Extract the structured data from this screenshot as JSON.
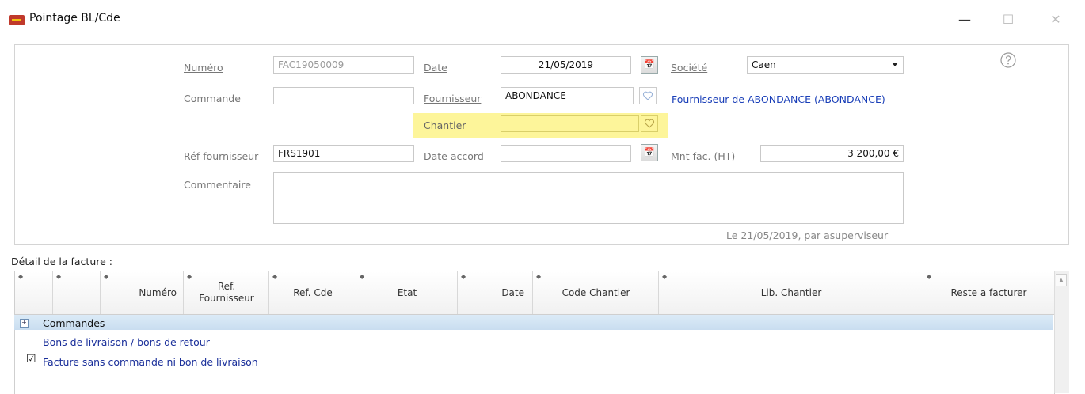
{
  "window": {
    "title": "Pointage BL/Cde",
    "minimize_glyph": "—",
    "maximize_glyph": "☐",
    "close_glyph": "✕"
  },
  "form": {
    "numero": {
      "label": "Numéro",
      "value": "FAC19050009"
    },
    "date": {
      "label": "Date",
      "value": "21/05/2019"
    },
    "societe": {
      "label": "Société",
      "value": "Caen"
    },
    "commande": {
      "label": "Commande",
      "value": ""
    },
    "fournisseur": {
      "label": "Fournisseur",
      "value": "ABONDANCE",
      "link": "Fournisseur de ABONDANCE (ABONDANCE)"
    },
    "chantier": {
      "label": "Chantier",
      "value": ""
    },
    "ref_fournisseur": {
      "label": "Réf fournisseur",
      "value": "FRS1901"
    },
    "date_accord": {
      "label": "Date accord",
      "value": ""
    },
    "mnt_fac": {
      "label": "Mnt fac. (HT)",
      "value": "3 200,00 €"
    },
    "commentaire": {
      "label": "Commentaire",
      "value": ""
    },
    "calendar_icon": "calendar-icon",
    "audit": "Le 21/05/2019, par asuperviseur"
  },
  "details": {
    "title": "Détail de la facture :",
    "sort_glyph": "◆",
    "columns": [
      {
        "label": ""
      },
      {
        "label": ""
      },
      {
        "label": "Numéro"
      },
      {
        "label": "Ref.\nFournisseur"
      },
      {
        "label": "Ref. Cde"
      },
      {
        "label": "Etat"
      },
      {
        "label": "Date"
      },
      {
        "label": "Code Chantier"
      },
      {
        "label": "Lib. Chantier"
      },
      {
        "label": "Reste a facturer"
      }
    ],
    "rows": [
      {
        "label": "Commandes",
        "expand": "+"
      },
      {
        "label": "Bons de livraison / bons de retour"
      },
      {
        "label": "Facture sans commande ni bon de livraison",
        "checked": "☑"
      }
    ]
  },
  "colors": {
    "highlight": "#fdf59a",
    "link": "#1a3fb8",
    "row_selected": "#c9ddf0"
  }
}
